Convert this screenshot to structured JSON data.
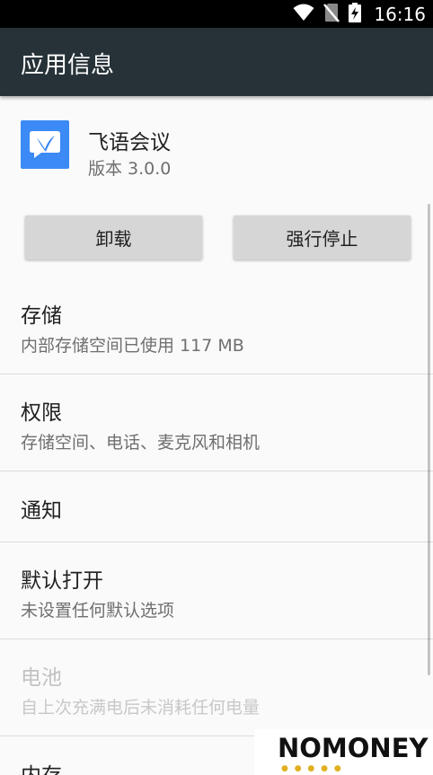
{
  "status_bar": {
    "time": "16:16",
    "icons": [
      "wifi-icon",
      "no-sim-icon",
      "battery-charging-icon"
    ]
  },
  "app_bar": {
    "title": "应用信息"
  },
  "app": {
    "name": "飞语会议",
    "version": "版本 3.0.0",
    "icon": "feiyu-app-icon",
    "icon_color": "#3b8af5"
  },
  "buttons": {
    "uninstall": "卸载",
    "force_stop": "强行停止"
  },
  "settings": [
    {
      "title": "存储",
      "subtitle": "内部存储空间已使用 117 MB",
      "enabled": true
    },
    {
      "title": "权限",
      "subtitle": "存储空间、电话、麦克风和相机",
      "enabled": true
    },
    {
      "title": "通知",
      "subtitle": "",
      "enabled": true
    },
    {
      "title": "默认打开",
      "subtitle": "未设置任何默认选项",
      "enabled": true
    },
    {
      "title": "电池",
      "subtitle": "自上次充满电后未消耗任何电量",
      "enabled": false
    },
    {
      "title": "内存",
      "subtitle": "",
      "enabled": true
    }
  ],
  "watermark": {
    "text": "NOMONEY"
  },
  "colors": {
    "app_bar": "#263238",
    "background": "#fafafa",
    "button": "#d6d6d6"
  }
}
